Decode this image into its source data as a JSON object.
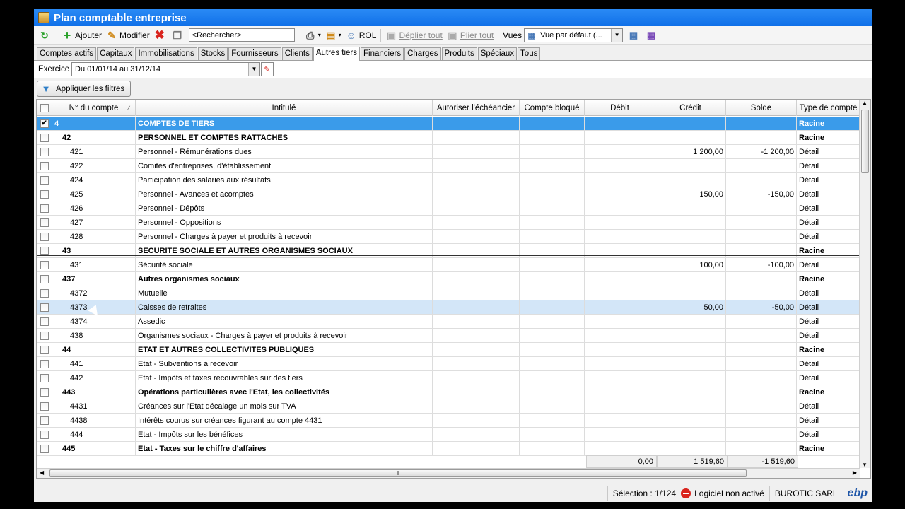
{
  "window": {
    "title": "Plan comptable entreprise"
  },
  "toolbar": {
    "add_label": "Ajouter",
    "edit_label": "Modifier",
    "search_placeholder": "<Rechercher>",
    "rol_label": "ROL",
    "expand_label": "Déplier tout",
    "collapse_label": "Plier tout",
    "views_label": "Vues",
    "view_selected": "Vue par défaut (..."
  },
  "tabs": [
    "Comptes actifs",
    "Capitaux",
    "Immobilisations",
    "Stocks",
    "Fournisseurs",
    "Clients",
    "Autres tiers",
    "Financiers",
    "Charges",
    "Produits",
    "Spéciaux",
    "Tous"
  ],
  "active_tab": "Autres tiers",
  "exercice": {
    "label": "Exercice",
    "value": "Du 01/01/14 au 31/12/14"
  },
  "filters_button": "Appliquer les filtres",
  "columns": [
    "N° du compte",
    "Intitulé",
    "Autoriser l'échéancier",
    "Compte bloqué",
    "Débit",
    "Crédit",
    "Solde",
    "Type de compte"
  ],
  "rows": [
    {
      "code": "4",
      "label": "COMPTES DE TIERS",
      "debit": "",
      "credit": "",
      "solde": "",
      "type": "Racine",
      "level": 0,
      "checked": true
    },
    {
      "code": "42",
      "label": "PERSONNEL ET COMPTES RATTACHES",
      "debit": "",
      "credit": "",
      "solde": "",
      "type": "Racine",
      "level": 1
    },
    {
      "code": "421",
      "label": "Personnel - Rémunérations dues",
      "debit": "",
      "credit": "1 200,00",
      "solde": "-1 200,00",
      "type": "Détail",
      "level": 2
    },
    {
      "code": "422",
      "label": "Comités d'entreprises, d'établissement",
      "debit": "",
      "credit": "",
      "solde": "",
      "type": "Détail",
      "level": 2
    },
    {
      "code": "424",
      "label": "Participation des salariés aux résultats",
      "debit": "",
      "credit": "",
      "solde": "",
      "type": "Détail",
      "level": 2
    },
    {
      "code": "425",
      "label": "Personnel - Avances et acomptes",
      "debit": "",
      "credit": "150,00",
      "solde": "-150,00",
      "type": "Détail",
      "level": 2
    },
    {
      "code": "426",
      "label": "Personnel - Dépôts",
      "debit": "",
      "credit": "",
      "solde": "",
      "type": "Détail",
      "level": 2
    },
    {
      "code": "427",
      "label": "Personnel - Oppositions",
      "debit": "",
      "credit": "",
      "solde": "",
      "type": "Détail",
      "level": 2
    },
    {
      "code": "428",
      "label": "Personnel - Charges à payer et produits à recevoir",
      "debit": "",
      "credit": "",
      "solde": "",
      "type": "Détail",
      "level": 2
    },
    {
      "code": "43",
      "label": "SECURITE SOCIALE ET AUTRES ORGANISMES SOCIAUX",
      "debit": "",
      "credit": "",
      "solde": "",
      "type": "Racine",
      "level": 1
    },
    {
      "code": "431",
      "label": "Sécurité sociale",
      "debit": "",
      "credit": "100,00",
      "solde": "-100,00",
      "type": "Détail",
      "level": 2
    },
    {
      "code": "437",
      "label": "Autres organismes sociaux",
      "debit": "",
      "credit": "",
      "solde": "",
      "type": "Racine",
      "level": 1
    },
    {
      "code": "4372",
      "label": "Mutuelle",
      "debit": "",
      "credit": "",
      "solde": "",
      "type": "Détail",
      "level": 2
    },
    {
      "code": "4373",
      "label": "Caisses de retraites",
      "debit": "",
      "credit": "50,00",
      "solde": "-50,00",
      "type": "Détail",
      "level": 2,
      "hover": true
    },
    {
      "code": "4374",
      "label": "Assedic",
      "debit": "",
      "credit": "",
      "solde": "",
      "type": "Détail",
      "level": 2
    },
    {
      "code": "438",
      "label": "Organismes sociaux - Charges à payer et produits à recevoir",
      "debit": "",
      "credit": "",
      "solde": "",
      "type": "Détail",
      "level": 2
    },
    {
      "code": "44",
      "label": "ETAT ET AUTRES COLLECTIVITES PUBLIQUES",
      "debit": "",
      "credit": "",
      "solde": "",
      "type": "Racine",
      "level": 1
    },
    {
      "code": "441",
      "label": "Etat - Subventions à recevoir",
      "debit": "",
      "credit": "",
      "solde": "",
      "type": "Détail",
      "level": 2
    },
    {
      "code": "442",
      "label": "Etat - Impôts et taxes recouvrables sur des tiers",
      "debit": "",
      "credit": "",
      "solde": "",
      "type": "Détail",
      "level": 2
    },
    {
      "code": "443",
      "label": "Opérations particulières avec l'Etat, les collectivités",
      "debit": "",
      "credit": "",
      "solde": "",
      "type": "Racine",
      "level": 1
    },
    {
      "code": "4431",
      "label": "Créances sur l'Etat décalage un mois sur TVA",
      "debit": "",
      "credit": "",
      "solde": "",
      "type": "Détail",
      "level": 2
    },
    {
      "code": "4438",
      "label": "Intérêts courus sur créances figurant au compte 4431",
      "debit": "",
      "credit": "",
      "solde": "",
      "type": "Détail",
      "level": 2
    },
    {
      "code": "444",
      "label": "Etat - Impôts sur les bénéfices",
      "debit": "",
      "credit": "",
      "solde": "",
      "type": "Détail",
      "level": 2
    },
    {
      "code": "445",
      "label": "Etat - Taxes sur le chiffre d'affaires",
      "debit": "",
      "credit": "",
      "solde": "",
      "type": "Racine",
      "level": 1
    }
  ],
  "totals": {
    "debit": "0,00",
    "credit": "1 519,60",
    "solde": "-1 519,60"
  },
  "status": {
    "selection": "Sélection : 1/124",
    "license": "Logiciel non activé",
    "company": "BUROTIC SARL",
    "brand": "ebp"
  },
  "colors": {
    "title_bar": "#1a7ae8",
    "selection": "#3a9bea",
    "hover": "#d3e6f8",
    "delete": "#d9231c",
    "add": "#2aa12a"
  }
}
